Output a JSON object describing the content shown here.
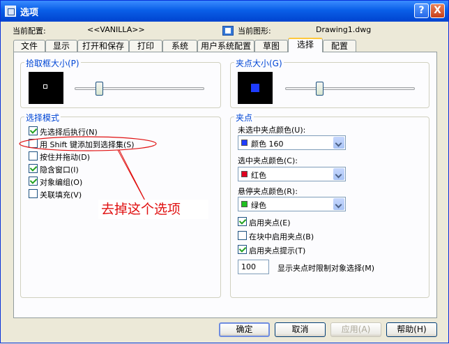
{
  "window": {
    "title": "选项"
  },
  "title_buttons": {
    "help": "?",
    "close": "X"
  },
  "header": {
    "profile_label": "当前配置:",
    "profile_value": "<<VANILLA>>",
    "drawing_label": "当前图形:",
    "drawing_value": "Drawing1.dwg"
  },
  "tabs": [
    {
      "label": "文件"
    },
    {
      "label": "显示"
    },
    {
      "label": "打开和保存"
    },
    {
      "label": "打印"
    },
    {
      "label": "系统"
    },
    {
      "label": "用户系统配置"
    },
    {
      "label": "草图"
    },
    {
      "label": "选择",
      "active": true
    },
    {
      "label": "配置"
    }
  ],
  "pickbox": {
    "title": "拾取框大小(P)",
    "value": 0.17
  },
  "gripsize": {
    "title": "夹点大小(G)",
    "value": 0.25
  },
  "selection_modes": {
    "title": "选择模式",
    "items": [
      {
        "label": "先选择后执行(N)",
        "checked": true
      },
      {
        "label": "用 Shift 键添加到选择集(S)",
        "checked": false
      },
      {
        "label": "按住并拖动(D)",
        "checked": false
      },
      {
        "label": "隐含窗口(I)",
        "checked": true
      },
      {
        "label": "对象编组(O)",
        "checked": true
      },
      {
        "label": "关联填充(V)",
        "checked": false
      }
    ]
  },
  "annotation": {
    "text": "去掉这个选项",
    "color": "#E01010"
  },
  "grips": {
    "title": "夹点",
    "unselected_label": "未选中夹点颜色(U):",
    "unselected_value": "颜色 160",
    "unselected_color": "#1E3CFF",
    "selected_label": "选中夹点颜色(C):",
    "selected_value": "红色",
    "selected_color": "#E00020",
    "hover_label": "悬停夹点颜色(R):",
    "hover_value": "绿色",
    "hover_color": "#20C020",
    "enable_grips": {
      "label": "启用夹点(E)",
      "checked": true
    },
    "grips_in_blocks": {
      "label": "在块中启用夹点(B)",
      "checked": false
    },
    "grip_tips": {
      "label": "启用夹点提示(T)",
      "checked": true
    },
    "limit_value": "100",
    "limit_label": "显示夹点时限制对象选择(M)"
  },
  "buttons": {
    "ok": "确定",
    "cancel": "取消",
    "apply": "应用(A)",
    "help": "帮助(H)"
  }
}
